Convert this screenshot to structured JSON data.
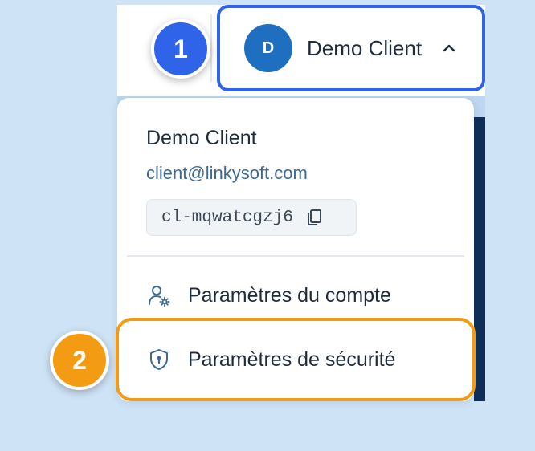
{
  "badges": {
    "step_1": "1",
    "step_2": "2"
  },
  "header": {
    "avatar_initial": "D",
    "user_name": "Demo Client",
    "chevron_icon": "chevron-up-icon"
  },
  "dropdown": {
    "name": "Demo Client",
    "email": "client@linkysoft.com",
    "client_id": "cl-mqwatcgzj6",
    "copy_icon": "copy-icon",
    "items": [
      {
        "label": "Paramètres du compte",
        "icon": "user-gear-icon"
      },
      {
        "label": "Paramètres de sécurité",
        "icon": "shield-lock-icon"
      }
    ]
  },
  "colors": {
    "background": "#cfe3f7",
    "step_1": "#2f63e8",
    "step_2": "#f29b13",
    "avatar": "#1f6fc0",
    "text": "#1d2b3a",
    "email": "#3e6a96"
  }
}
